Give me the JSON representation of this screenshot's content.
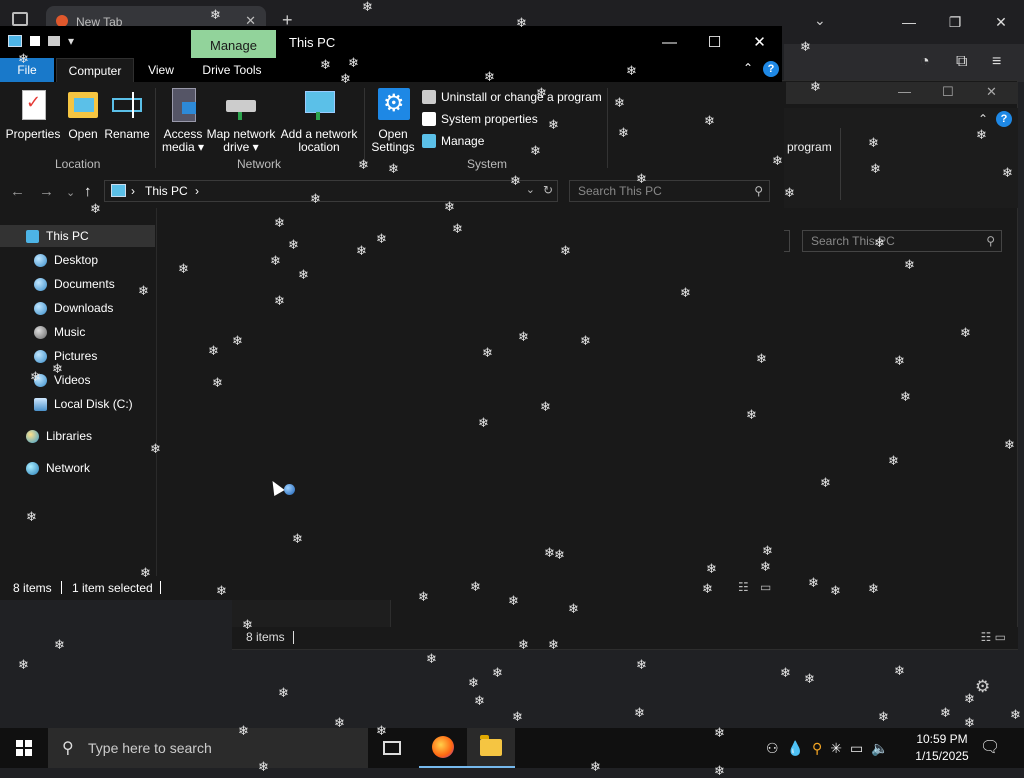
{
  "browser": {
    "tab_title": "New Tab",
    "new_tab": "+",
    "tab_close": "✕",
    "minimize": "—",
    "restore": "❐",
    "close": "✕",
    "chevron": "⌄",
    "toolbar_icons": [
      "extensions-icon",
      "menu-icon"
    ]
  },
  "explorer2": {
    "ribbon_fragment": "program",
    "search_placeholder": "Search This PC",
    "status_count": "8 items"
  },
  "explorer": {
    "context_tab": "Manage",
    "title": "This PC",
    "tabs": {
      "file": "File",
      "computer": "Computer",
      "view": "View",
      "drive_tools": "Drive Tools"
    },
    "ribbon": {
      "location": {
        "label": "Location",
        "properties": "Properties",
        "open": "Open",
        "rename": "Rename"
      },
      "network": {
        "label": "Network",
        "access_media": "Access\nmedia ▾",
        "map_network_drive": "Map network\ndrive ▾",
        "add_network_location": "Add a network\nlocation"
      },
      "system": {
        "label": "System",
        "open_settings": "Open\nSettings",
        "uninstall": "Uninstall or change a program",
        "system_properties": "System properties",
        "manage": "Manage"
      }
    },
    "address": {
      "root_sep": "›",
      "location": "This PC",
      "trail_sep": "›"
    },
    "search_placeholder": "Search This PC",
    "nav": [
      {
        "label": "This PC",
        "selected": true,
        "icon": "pc-icon"
      },
      {
        "label": "Desktop",
        "icon": "desktop-icon"
      },
      {
        "label": "Documents",
        "icon": "documents-icon"
      },
      {
        "label": "Downloads",
        "icon": "downloads-icon"
      },
      {
        "label": "Music",
        "icon": "music-icon"
      },
      {
        "label": "Pictures",
        "icon": "pictures-icon"
      },
      {
        "label": "Videos",
        "icon": "videos-icon"
      },
      {
        "label": "Local Disk (C:)",
        "icon": "disk-icon"
      },
      {
        "label": "Libraries",
        "icon": "libraries-icon"
      },
      {
        "label": "Network",
        "icon": "network-icon"
      }
    ],
    "status": {
      "count": "8 items",
      "selected": "1 item selected"
    }
  },
  "taskbar": {
    "search_placeholder": "Type here to search",
    "time": "10:59 PM",
    "date": "1/15/2025"
  }
}
